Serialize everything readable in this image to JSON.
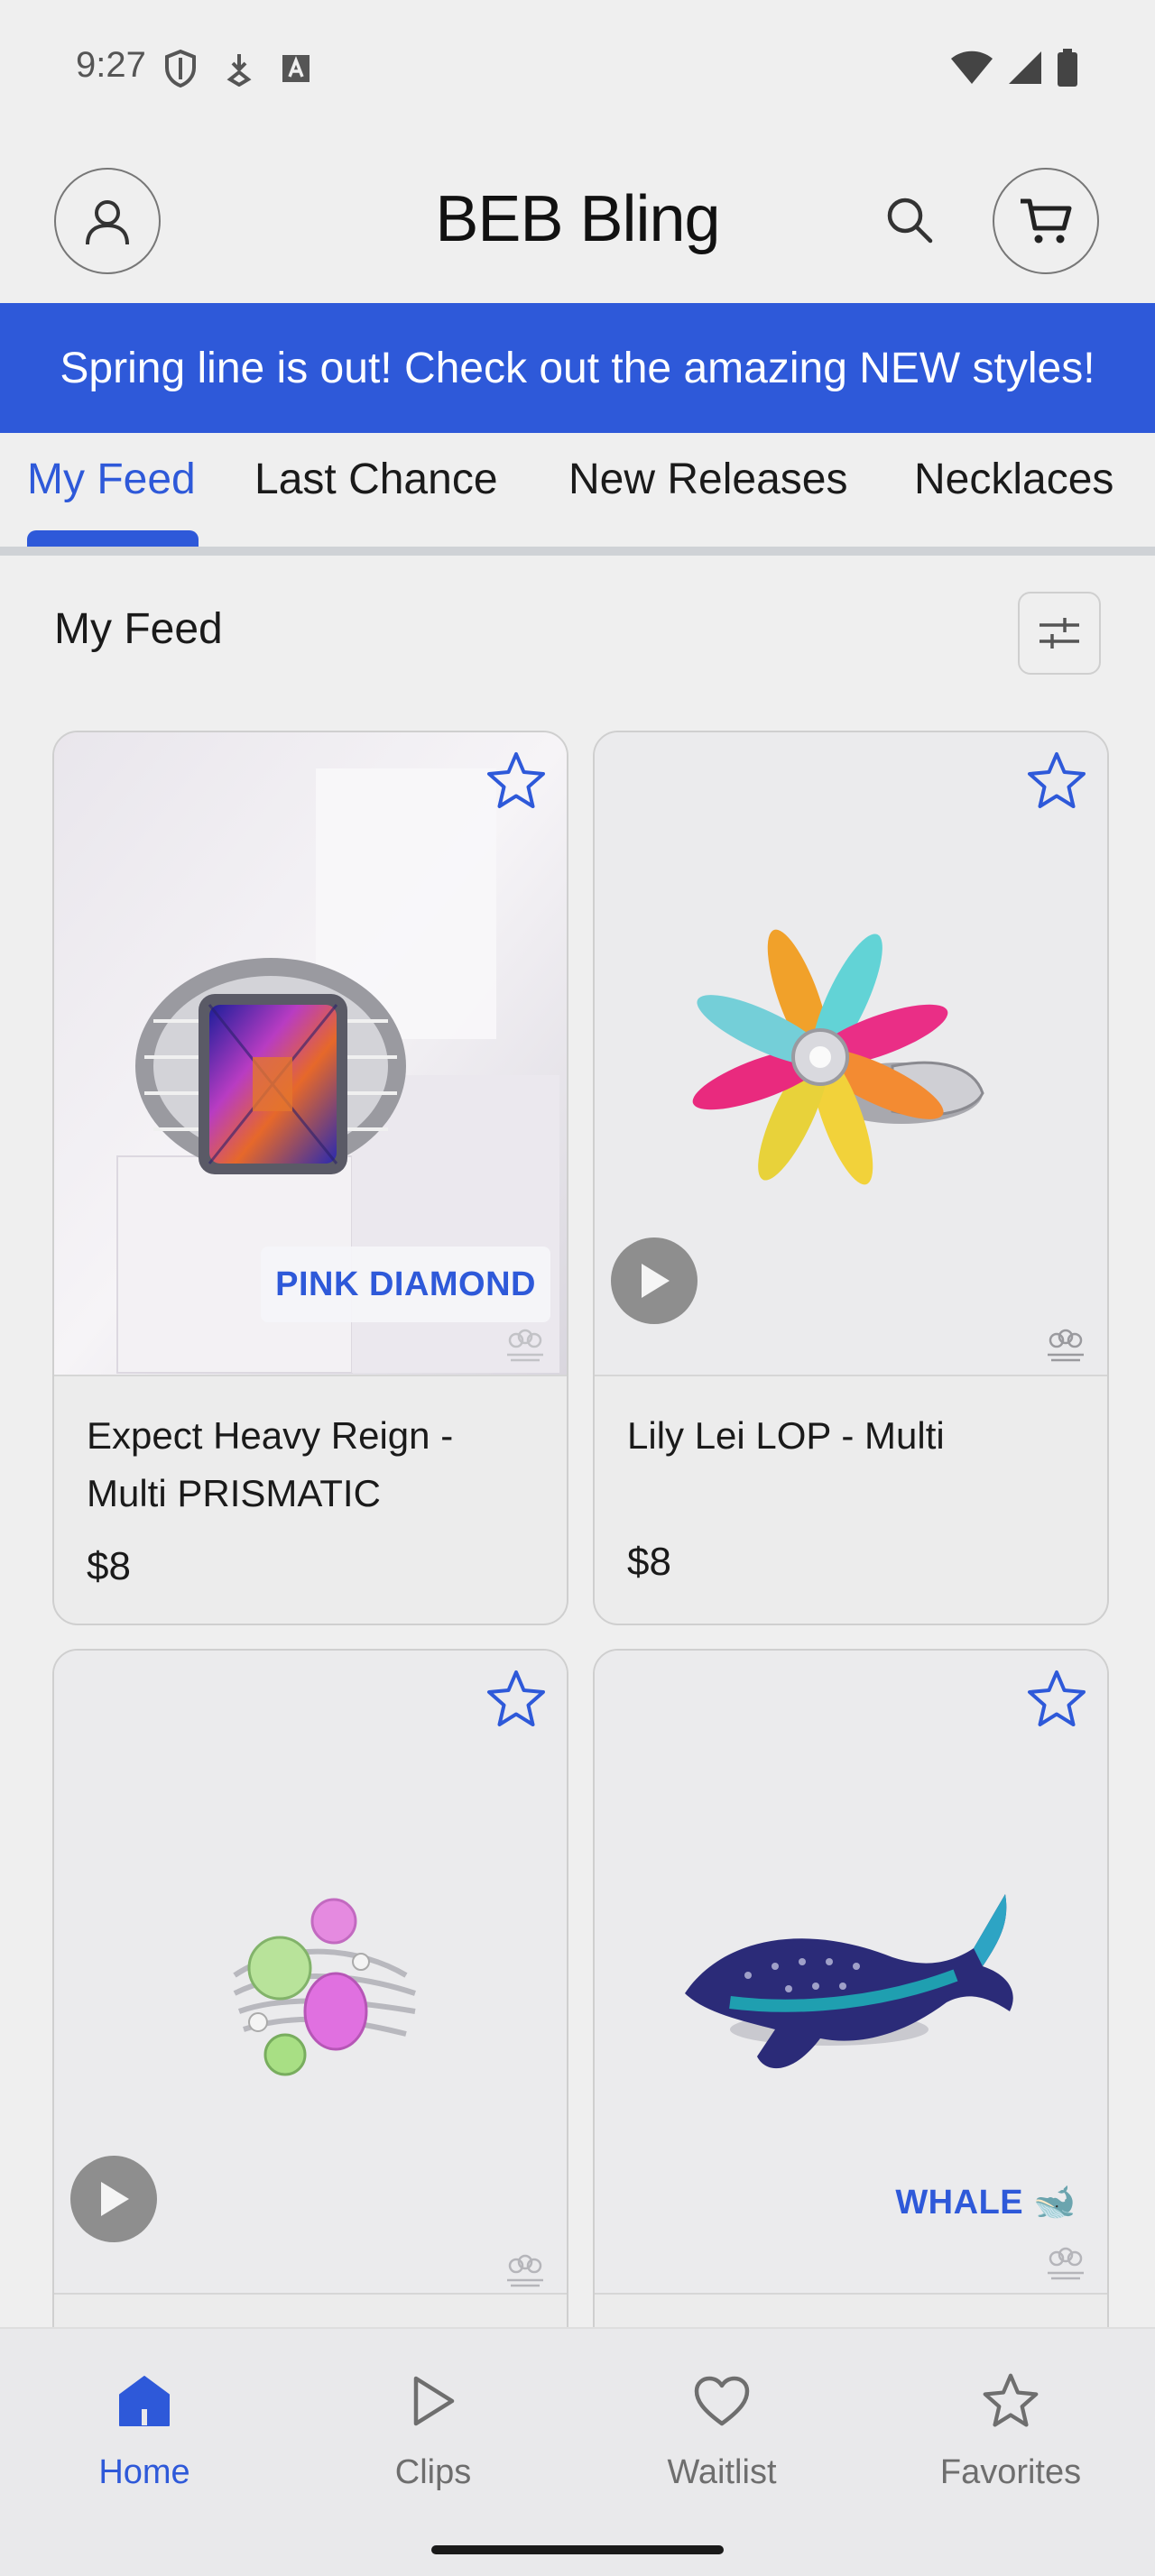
{
  "status_bar": {
    "time": "9:27"
  },
  "header": {
    "title": "BEB Bling"
  },
  "banner": {
    "text": "Spring line is out! Check out the amazing NEW styles!"
  },
  "tabs": [
    {
      "label": "My Feed",
      "active": true
    },
    {
      "label": "Last Chance"
    },
    {
      "label": "New Releases"
    },
    {
      "label": "Necklaces"
    }
  ],
  "section": {
    "title": "My Feed"
  },
  "products": [
    {
      "name": "Expect Heavy Reign - Multi PRISMATIC",
      "price": "$8",
      "badge": "PINK DIAMOND",
      "has_video": false
    },
    {
      "name": "Lily Lei LOP - Multi",
      "price": "$8",
      "badge": "",
      "has_video": true
    },
    {
      "name": "",
      "price": "",
      "badge": "",
      "has_video": true
    },
    {
      "name": "",
      "price": "",
      "badge": "WHALE 🐋",
      "has_video": false
    }
  ],
  "bottom_nav": [
    {
      "label": "Home",
      "icon": "home-icon",
      "active": true
    },
    {
      "label": "Clips",
      "icon": "play-icon"
    },
    {
      "label": "Waitlist",
      "icon": "heart-icon"
    },
    {
      "label": "Favorites",
      "icon": "star-icon"
    }
  ],
  "colors": {
    "accent": "#2e59d9",
    "background": "#efefef"
  }
}
